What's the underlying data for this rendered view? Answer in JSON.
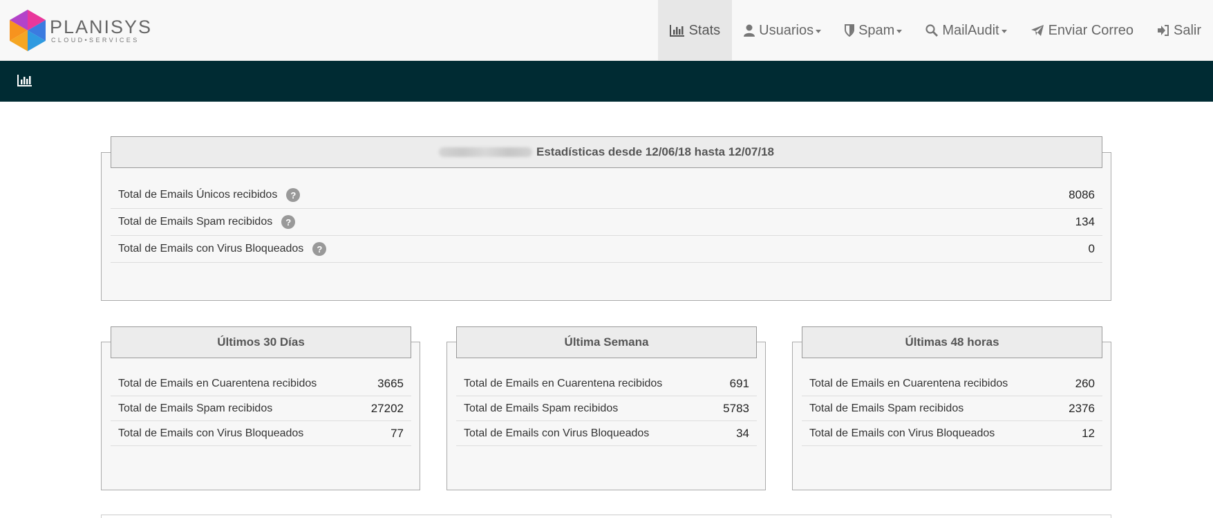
{
  "brand": {
    "name": "PLANISYS",
    "sub": "CLOUD•SERVICES"
  },
  "nav": [
    {
      "label": "Stats",
      "icon": "bar-chart-icon",
      "caret": false,
      "active": true
    },
    {
      "label": "Usuarios",
      "icon": "user-icon",
      "caret": true,
      "active": false
    },
    {
      "label": "Spam",
      "icon": "shield-icon",
      "caret": true,
      "active": false
    },
    {
      "label": "MailAudit",
      "icon": "search-icon",
      "caret": true,
      "active": false
    },
    {
      "label": "Enviar Correo",
      "icon": "paper-plane-icon",
      "caret": false,
      "active": false
    },
    {
      "label": "Salir",
      "icon": "sign-out-icon",
      "caret": false,
      "active": false
    }
  ],
  "subbar": {
    "icon": "bar-chart-icon"
  },
  "summary": {
    "title": "Estadísticas desde 12/06/18 hasta 12/07/18",
    "rows": [
      {
        "label": "Total de Emails Únicos recibidos",
        "value": "8086",
        "help": "?"
      },
      {
        "label": "Total de Emails Spam recibidos",
        "value": "134",
        "help": "?"
      },
      {
        "label": "Total de Emails con Virus Bloqueados",
        "value": "0",
        "help": "?"
      }
    ]
  },
  "periods": [
    {
      "title": "Últimos 30 Días",
      "rows": [
        {
          "label": "Total de Emails en Cuarentena recibidos",
          "value": "3665"
        },
        {
          "label": "Total de Emails Spam recibidos",
          "value": "27202"
        },
        {
          "label": "Total de Emails con Virus Bloqueados",
          "value": "77"
        }
      ]
    },
    {
      "title": "Última Semana",
      "rows": [
        {
          "label": "Total de Emails en Cuarentena recibidos",
          "value": "691"
        },
        {
          "label": "Total de Emails Spam recibidos",
          "value": "5783"
        },
        {
          "label": "Total de Emails con Virus Bloqueados",
          "value": "34"
        }
      ]
    },
    {
      "title": "Últimas 48 horas",
      "rows": [
        {
          "label": "Total de Emails en Cuarentena recibidos",
          "value": "260"
        },
        {
          "label": "Total de Emails Spam recibidos",
          "value": "2376"
        },
        {
          "label": "Total de Emails con Virus Bloqueados",
          "value": "12"
        }
      ]
    }
  ],
  "colors": {
    "navbar": "#f8f8f8",
    "subbar": "#002b33",
    "panel": "#f7f7f7",
    "help": "#999999"
  }
}
